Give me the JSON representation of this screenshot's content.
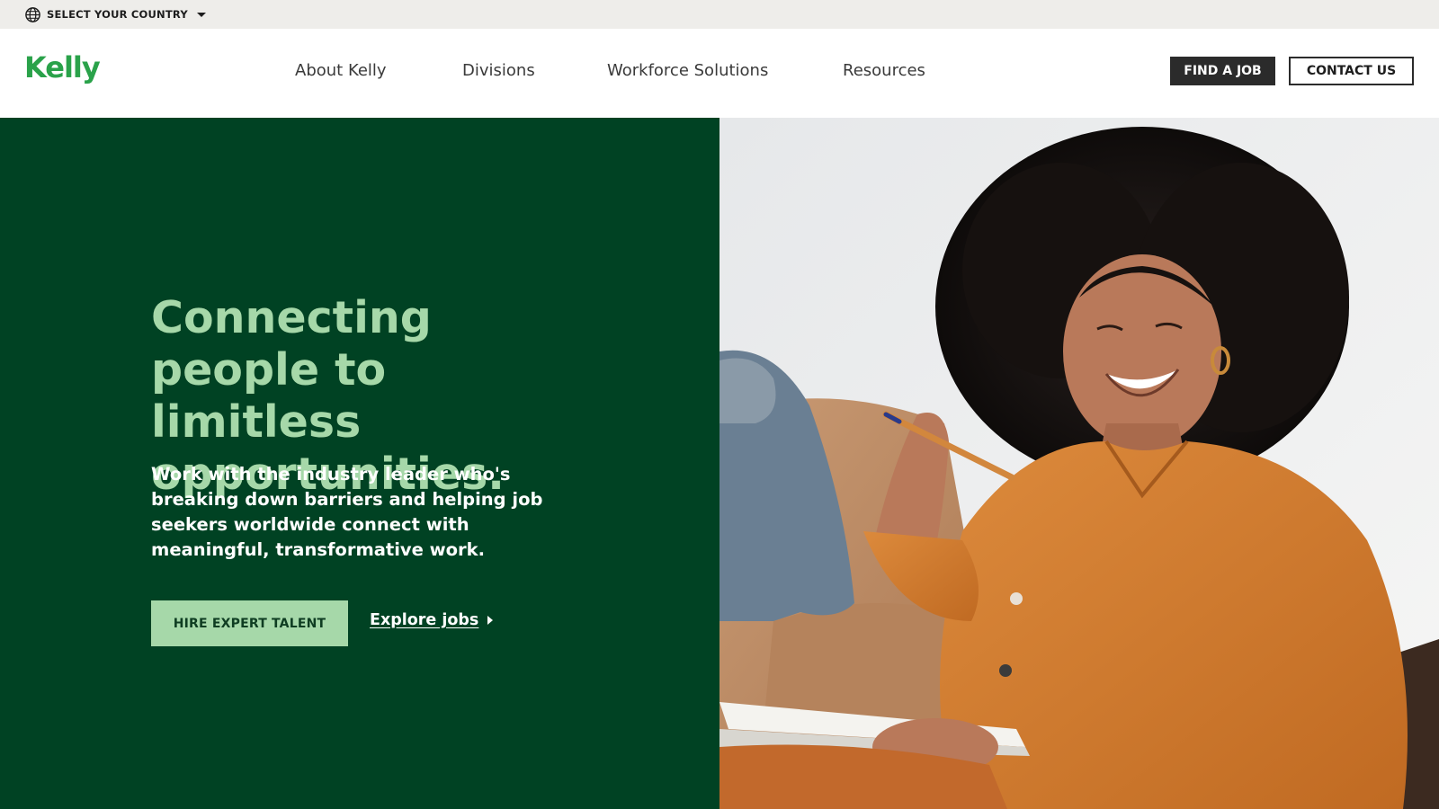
{
  "utility_bar": {
    "country_select_label": "SELECT YOUR COUNTRY",
    "globe_icon": "globe-icon",
    "caret_icon": "caret-down-icon"
  },
  "header": {
    "logo_text": "Kelly",
    "nav": [
      {
        "label": "About Kelly"
      },
      {
        "label": "Divisions"
      },
      {
        "label": "Workforce Solutions"
      },
      {
        "label": "Resources"
      }
    ],
    "find_job_label": "FIND A JOB",
    "contact_label": "CONTACT US"
  },
  "hero": {
    "title": "Connecting people to limitless opportunities.",
    "subtitle": "Work with the industry leader who's breaking down barriers and helping job seekers worldwide connect with meaningful, transformative work.",
    "primary_cta": "HIRE EXPERT TALENT",
    "secondary_cta": "Explore jobs",
    "secondary_cta_icon": "caret-right-icon"
  },
  "colors": {
    "brand_green": "#2aa24a",
    "hero_green": "#004223",
    "light_green": "#a6d8a9",
    "dark_button": "#2b2b2b",
    "utility_bg": "#eeedea"
  }
}
